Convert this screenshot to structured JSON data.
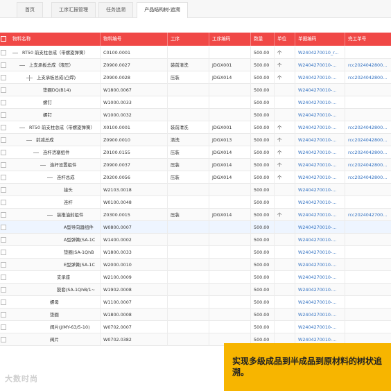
{
  "tabs": [
    {
      "label": "首页",
      "active": false
    },
    {
      "label": "工序汇报管理",
      "active": false
    },
    {
      "label": "任务追溯",
      "active": false
    },
    {
      "label": "产品结构树-追溯",
      "active": true
    }
  ],
  "table": {
    "columns": [
      "物料名称",
      "物料编号",
      "工序",
      "工序编码",
      "数量",
      "单位",
      "单据编码",
      "完工单号"
    ],
    "rows": [
      {
        "name": "RT50 前支柱总成（带螺旋弹簧）",
        "icon": "dash",
        "code": "C0100.0001",
        "process": "",
        "process_code": "",
        "qty": "500.00",
        "unit": "个",
        "doc": "W2404270010_r...",
        "finish": ""
      },
      {
        "name": "上支承板总成（液压）",
        "icon": "dash",
        "code": "Z0900.0027",
        "process": "装前清洗",
        "process_code": "JDGX001",
        "qty": "500.00",
        "unit": "个",
        "doc": "W2404270010-...",
        "finish": "rcc2024042800..."
      },
      {
        "name": "上支承板总成(凸焊)",
        "icon": "plus",
        "code": "Z0900.0028",
        "process": "压装",
        "process_code": "JDGX014",
        "qty": "500.00",
        "unit": "个",
        "doc": "W2404270010-...",
        "finish": "rcc2024042800..."
      },
      {
        "name": "垫圈DQ(B14)",
        "icon": "none",
        "code": "W1800.0067",
        "process": "",
        "process_code": "",
        "qty": "500.00",
        "unit": "",
        "doc": "W2404270010-...",
        "finish": ""
      },
      {
        "name": "螺钉",
        "icon": "none",
        "code": "W1000.0033",
        "process": "",
        "process_code": "",
        "qty": "500.00",
        "unit": "",
        "doc": "W2404270010-...",
        "finish": ""
      },
      {
        "name": "螺钉",
        "icon": "none",
        "code": "W1000.0032",
        "process": "",
        "process_code": "",
        "qty": "500.00",
        "unit": "",
        "doc": "W2404270010-...",
        "finish": ""
      },
      {
        "name": "RT50 前支柱总成（带螺旋弹簧）",
        "icon": "dash",
        "code": "X0100.0001",
        "process": "装前清洗",
        "process_code": "JDGX001",
        "qty": "500.00",
        "unit": "个",
        "doc": "W2404270010-...",
        "finish": "rcc2024042800..."
      },
      {
        "name": "前减总成",
        "icon": "dash",
        "code": "Z0900.0010",
        "process": "清洗",
        "process_code": "JDGX013",
        "qty": "500.00",
        "unit": "个",
        "doc": "W2404270010-...",
        "finish": "rcc2024042800..."
      },
      {
        "name": "连杆活塞组件",
        "icon": "dash",
        "code": "Z0100.0155",
        "process": "压装",
        "process_code": "JDGX014",
        "qty": "500.00",
        "unit": "个",
        "doc": "W2404270010-...",
        "finish": "rcc2024042800..."
      },
      {
        "name": "连杆设置组件",
        "icon": "dash",
        "code": "Z0900.0037",
        "process": "压装",
        "process_code": "JDGX014",
        "qty": "500.00",
        "unit": "个",
        "doc": "W2404270010-...",
        "finish": "rcc2024042800..."
      },
      {
        "name": "连杆总成",
        "icon": "dash",
        "code": "Z0200.0056",
        "process": "压装",
        "process_code": "JDGX014",
        "qty": "500.00",
        "unit": "个",
        "doc": "W2404270010-...",
        "finish": "rcc2024042800..."
      },
      {
        "name": "接头",
        "icon": "none",
        "code": "W2103.0018",
        "process": "",
        "process_code": "",
        "qty": "500.00",
        "unit": "",
        "doc": "W2404270010-...",
        "finish": ""
      },
      {
        "name": "连杆",
        "icon": "none",
        "code": "W0100.0048",
        "process": "",
        "process_code": "",
        "qty": "500.00",
        "unit": "",
        "doc": "W2404270010-...",
        "finish": ""
      },
      {
        "name": "装推油封组件",
        "icon": "dash",
        "code": "Z0300.0015",
        "process": "压装",
        "process_code": "JDGX014",
        "qty": "500.00",
        "unit": "个",
        "doc": "W2404270010-...",
        "finish": "rcc2024042700..."
      },
      {
        "name": "A型导向器组件",
        "icon": "none",
        "code": "W0800.0007",
        "process": "",
        "process_code": "",
        "qty": "500.00",
        "unit": "",
        "doc": "W2404270010-...",
        "finish": ""
      },
      {
        "name": "A型弹簧(SA-1C",
        "icon": "none",
        "code": "W1400.0002",
        "process": "",
        "process_code": "",
        "qty": "500.00",
        "unit": "",
        "doc": "W2404270010-...",
        "finish": ""
      },
      {
        "name": "垫圈(SA-1QhB",
        "icon": "none",
        "code": "W1800.0033",
        "process": "",
        "process_code": "",
        "qty": "500.00",
        "unit": "",
        "doc": "W2404270010-...",
        "finish": ""
      },
      {
        "name": "E型弹簧(SA-1C",
        "icon": "none",
        "code": "W2000.0010",
        "process": "",
        "process_code": "",
        "qty": "500.00",
        "unit": "",
        "doc": "W2404270010-...",
        "finish": ""
      },
      {
        "name": "支承座",
        "icon": "none",
        "code": "W2100.0009",
        "process": "",
        "process_code": "",
        "qty": "500.00",
        "unit": "",
        "doc": "W2404270010-...",
        "finish": ""
      },
      {
        "name": "胶套(SA-1QhB/1~",
        "icon": "none",
        "code": "W1902.0008",
        "process": "",
        "process_code": "",
        "qty": "500.00",
        "unit": "",
        "doc": "W2404270010-...",
        "finish": ""
      },
      {
        "name": "螺母",
        "icon": "none",
        "code": "W1100.0007",
        "process": "",
        "process_code": "",
        "qty": "500.00",
        "unit": "",
        "doc": "W2404270010-...",
        "finish": ""
      },
      {
        "name": "垫圈",
        "icon": "none",
        "code": "W1800.0008",
        "process": "",
        "process_code": "",
        "qty": "500.00",
        "unit": "",
        "doc": "W2404270010-...",
        "finish": ""
      },
      {
        "name": "阀片(J/MY-63/5-10)",
        "icon": "none",
        "code": "W0702.0007",
        "process": "",
        "process_code": "",
        "qty": "500.00",
        "unit": "",
        "doc": "W2404270010-...",
        "finish": ""
      },
      {
        "name": "阀片",
        "icon": "none",
        "code": "W0702.0382",
        "process": "",
        "process_code": "",
        "qty": "500.00",
        "unit": "",
        "doc": "W2404270010-...",
        "finish": ""
      }
    ]
  },
  "callout": {
    "text": "实现多级成品到半成品到原材料的树状追溯。"
  },
  "watermark": {
    "text": "大数时尚"
  },
  "colors": {
    "header": "#f04846",
    "link": "#2f6fc0",
    "callout": "#f7b500",
    "selected_row": "#eef5ff"
  }
}
